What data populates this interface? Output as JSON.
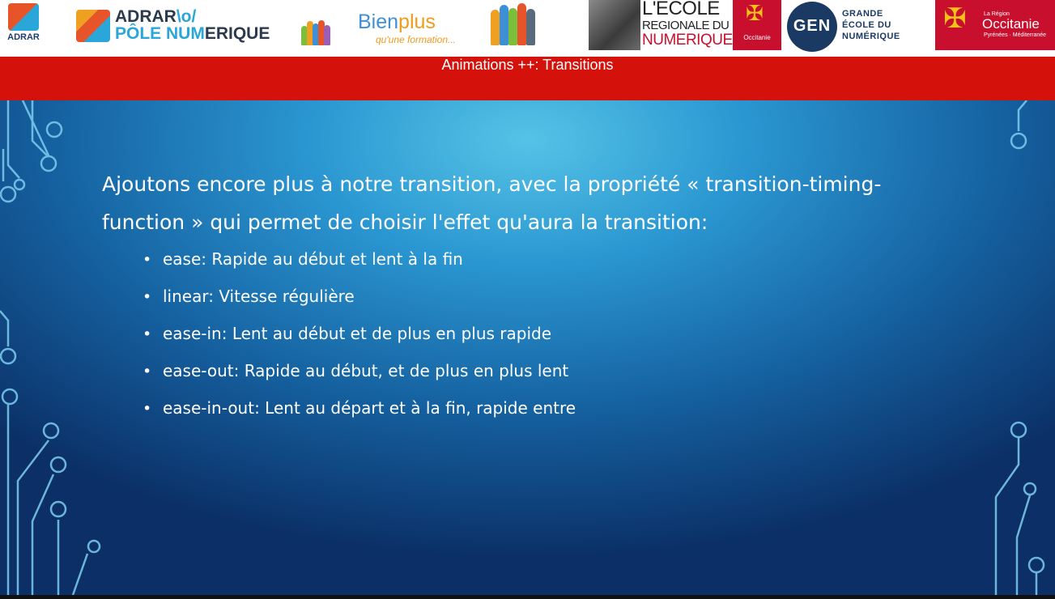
{
  "logos": {
    "adrar_small": "ADRAR",
    "adrar_pole_line1": "ADRAR",
    "adrar_pole_line1_mark": "\\o/",
    "adrar_pole_line2_a": "PÔLE NUM",
    "adrar_pole_line2_b": "ERIQUE",
    "bienplus_a": "Bien",
    "bienplus_b": "plus",
    "bienplus_tagline": "qu'une formation...",
    "ecole_reg_line1": "L'ECOLE",
    "ecole_reg_line2": "REGIONALE DU",
    "ecole_reg_line3": "NUMERIQUE",
    "occitanie_small": "Occitanie",
    "gen_mark": "GEN",
    "gen_line1": "GRANDE",
    "gen_line2": "ÉCOLE DU",
    "gen_line3": "NUMÉRIQUE",
    "occitanie_la_region": "La Région",
    "occitanie_big": "Occitanie",
    "occitanie_sub": "Pyrénées · Méditerranée"
  },
  "title": "Animations ++: Transitions",
  "intro": "Ajoutons encore plus à notre transition, avec la propriété « transition-timing-function » qui permet de choisir l'effet qu'aura la transition:",
  "bullets": [
    "ease: Rapide au début et lent à la fin",
    "linear: Vitesse régulière",
    "ease-in: Lent au début et de plus en plus rapide",
    "ease-out: Rapide au début, et de plus en plus lent",
    "ease-in-out: Lent au départ et à la fin, rapide entre"
  ],
  "icons": {
    "bullet": "disc-bullet-icon",
    "occitanie_cross": "occitan-cross-icon"
  },
  "colors": {
    "title_bar": "#d4120b",
    "accent_blue": "#2aa7d8",
    "background_top": "#55c3e6",
    "background_bottom": "#0b2f66"
  }
}
